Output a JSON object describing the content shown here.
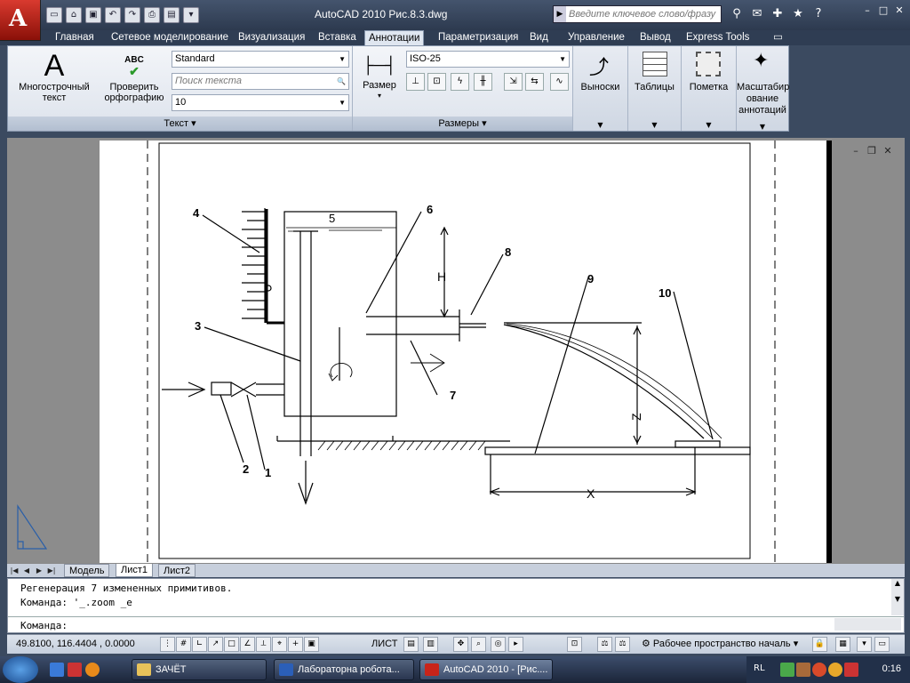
{
  "window": {
    "title": "AutoCAD 2010    Рис.8.3.dwg",
    "search_placeholder": "Введите ключевое слово/фразу"
  },
  "ribbon_tabs": [
    "Главная",
    "Сетевое моделирование",
    "Визуализация",
    "Вставка",
    "Аннотации",
    "Параметризация",
    "Вид",
    "Управление",
    "Вывод",
    "Express Tools"
  ],
  "active_tab": "Аннотации",
  "text_panel": {
    "title": "Текст",
    "mtext_label_1": "Многострочный",
    "mtext_label_2": "текст",
    "spell_glyph": "ABC",
    "spell_label_1": "Проверить",
    "spell_label_2": "орфографию",
    "style_value": "Standard",
    "find_placeholder": "Поиск текста",
    "height_value": "10"
  },
  "dim_panel": {
    "title": "Размеры",
    "dim_label": "Размер",
    "dimstyle_value": "ISO-25"
  },
  "other_panels": {
    "leaders": "Выноски",
    "tables": "Таблицы",
    "markup": "Пометка",
    "scale_1": "Масштабир",
    "scale_2": "ование",
    "scale_3": "аннотаций"
  },
  "drawing": {
    "labels": [
      "1",
      "2",
      "3",
      "4",
      "5",
      "6",
      "7",
      "8",
      "9",
      "10"
    ],
    "dim_h": "H",
    "dim_z": "Z",
    "dim_x": "X"
  },
  "layout_tabs": [
    "Модель",
    "Лист1",
    "Лист2"
  ],
  "active_layout": "Лист1",
  "command": {
    "line1": "Регенерация 7 измененных примитивов.",
    "line2": "Команда: '_.zoom _e",
    "prompt": "Команда:"
  },
  "status": {
    "coords": "49.8100,  116.4404 , 0.0000",
    "paper_label": "ЛИСТ",
    "workspace": "Рабочее пространство началь"
  },
  "taskbar": {
    "items": [
      "ЗАЧЁТ",
      "Лабораторна робота...",
      "AutoCAD 2010 - [Рис...."
    ],
    "lang": "RL",
    "time": "0:16"
  },
  "colors": {
    "app_red": "#c8241a",
    "title_bg": "#34435a",
    "ribbon_bg": "#e6eaf1"
  }
}
